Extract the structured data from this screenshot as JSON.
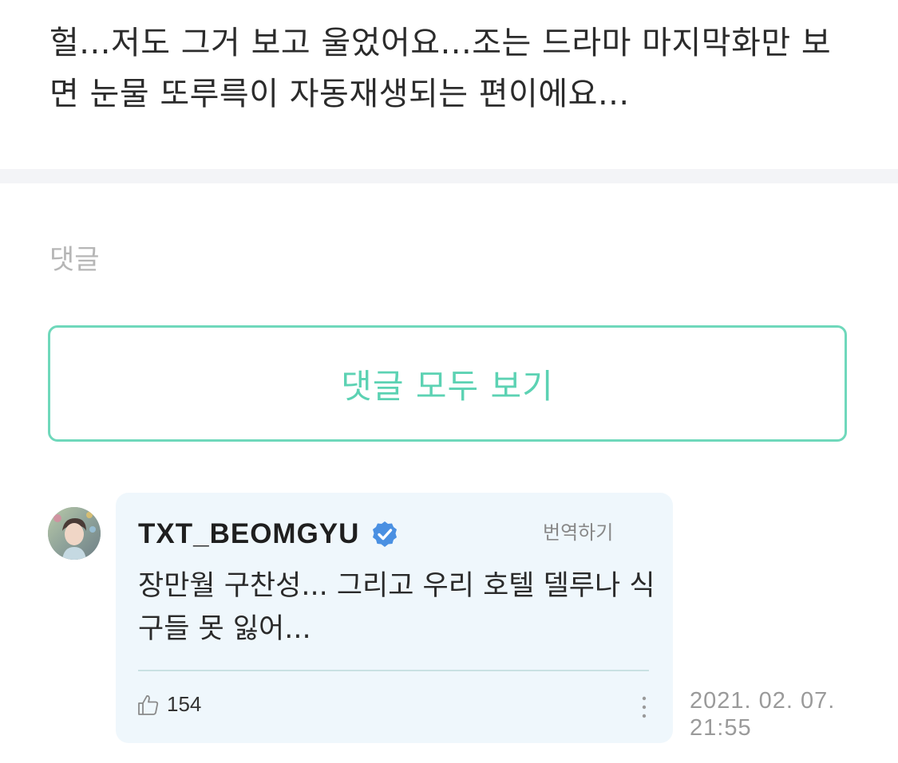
{
  "post": {
    "text": "헐...저도 그거 보고 울었어요...조는 드라마 마지막화만 보면 눈물 또루륵이 자동재생되는 편이에요..."
  },
  "comments_section": {
    "label": "댓글",
    "view_all_label": "댓글 모두 보기"
  },
  "comment": {
    "author": "TXT_BEOMGYU",
    "verified_icon": "verified-badge-icon",
    "translate_label": "번역하기",
    "body": "장만월 구찬성... 그리고 우리 호텔 델루나 식구들 못 잃어...",
    "like_icon": "thumbs-up-icon",
    "like_count": "154",
    "more_icon": "more-vertical-icon",
    "timestamp": "2021. 02. 07. 21:55"
  },
  "colors": {
    "accent": "#5cd2b3",
    "verified": "#4a90e2",
    "card_background": "#eff7fc"
  }
}
